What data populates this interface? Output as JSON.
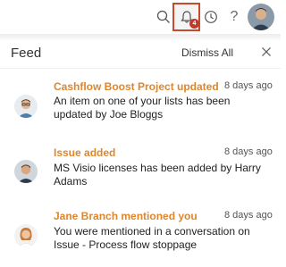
{
  "topbar": {
    "notification_count": "4",
    "help_glyph": "?",
    "icons": [
      "search-icon",
      "bell-icon",
      "clock-icon",
      "help-icon"
    ]
  },
  "feed": {
    "title": "Feed",
    "dismiss_all_label": "Dismiss All",
    "items": [
      {
        "title": "Cashflow Boost Project updated",
        "time": "8 days ago",
        "body": "An item on one of your lists has been updated by Joe Bloggs"
      },
      {
        "title": "Issue added",
        "time": "8 days ago",
        "body": "MS Visio licenses has been added by Harry Adams"
      },
      {
        "title": "Jane Branch mentioned you",
        "time": "8 days ago",
        "body": "You were mentioned in a conversation on Issue - Process flow stoppage"
      }
    ]
  },
  "colors": {
    "accent": "#e0862a",
    "badge": "#c0392b",
    "bell_highlight": "#c94a2a"
  }
}
